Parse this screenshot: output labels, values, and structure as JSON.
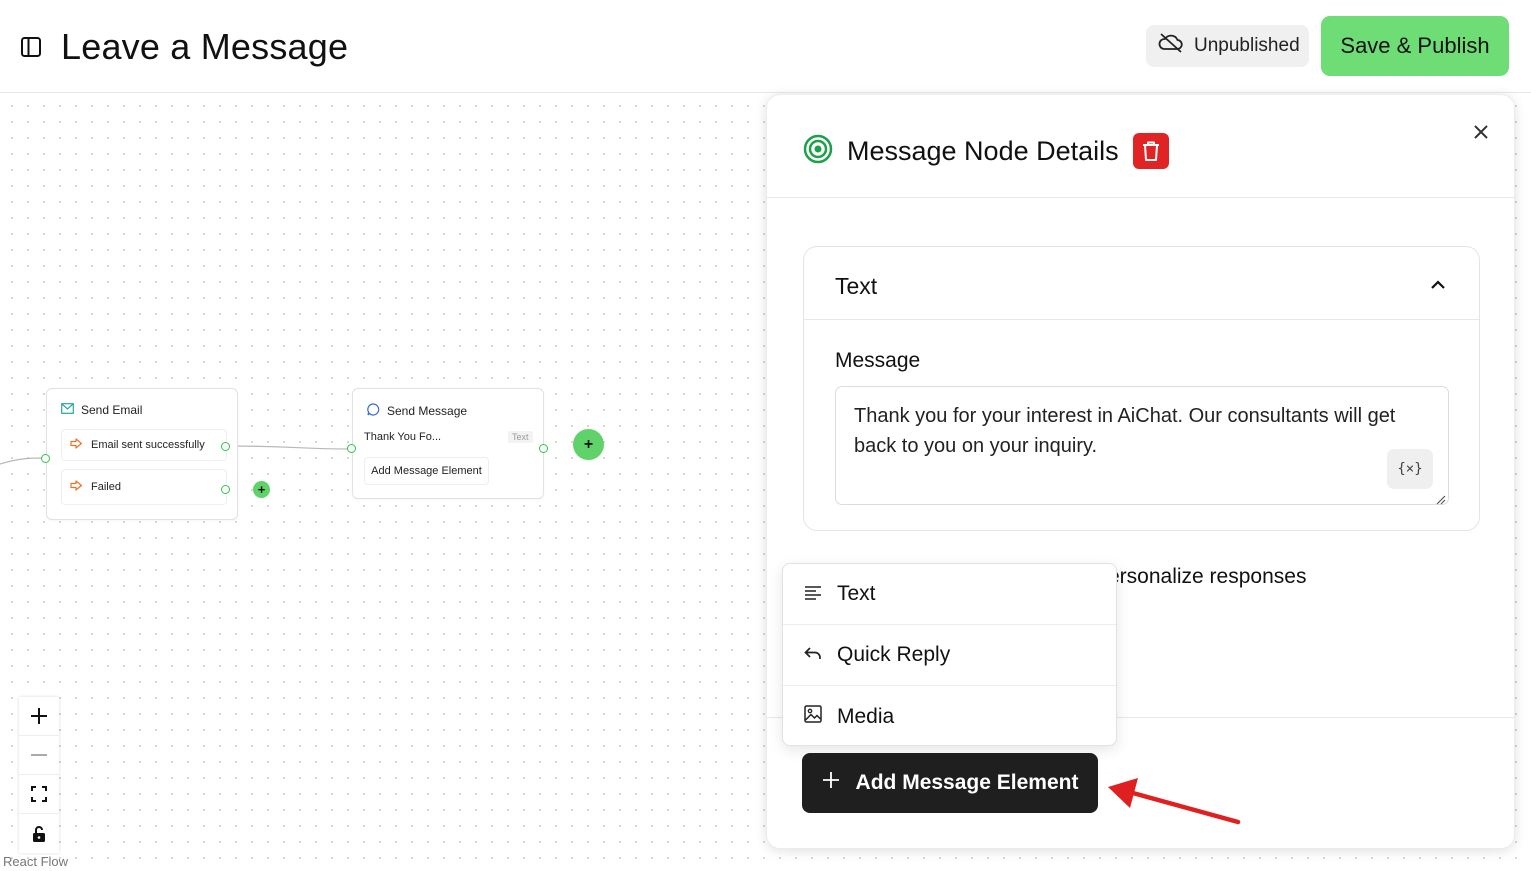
{
  "header": {
    "title": "Leave a Message",
    "status_label": "Unpublished",
    "publish_label": "Save & Publish"
  },
  "flow": {
    "send_email_node": {
      "title": "Send Email",
      "rows": [
        "Email sent successfully",
        "Failed"
      ]
    },
    "send_message_node": {
      "title": "Send Message",
      "preview": "Thank You Fo...",
      "badge": "Text",
      "add_label": "Add Message Element"
    },
    "attribution": "React Flow"
  },
  "panel": {
    "title": "Message Node Details",
    "card": {
      "title": "Text",
      "field_label": "Message",
      "message_value": "Thank you for your interest in AiChat. Our consultants will get back to you on your inquiry.",
      "variable_button": "{×}"
    },
    "hint_text": "ersonalize responses",
    "dropdown": {
      "items": [
        {
          "label": "Text",
          "icon": "text-lines-icon"
        },
        {
          "label": "Quick Reply",
          "icon": "reply-icon"
        },
        {
          "label": "Media",
          "icon": "image-icon"
        }
      ]
    },
    "add_element_label": "Add Message Element"
  },
  "colors": {
    "publish_green": "#6fdd76",
    "delete_red": "#e02424",
    "handle_green": "#33c24d",
    "annotation_arrow": "#e02020",
    "primary_dark": "#1f1f1f"
  }
}
